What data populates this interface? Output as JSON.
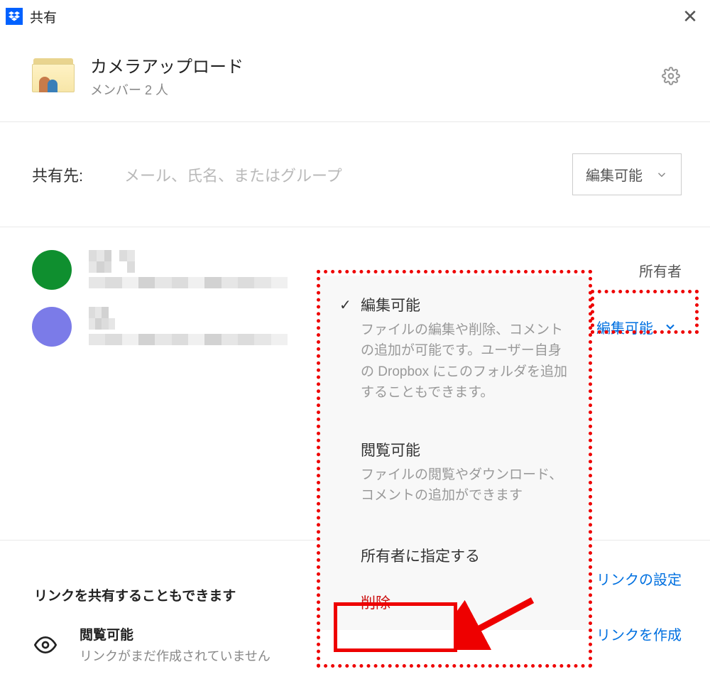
{
  "window": {
    "title": "共有"
  },
  "folder": {
    "name": "カメラアップロード",
    "members_label": "メンバー 2 人"
  },
  "share": {
    "label": "共有先:",
    "placeholder": "メール、氏名、またはグループ",
    "permission_selected": "編集可能"
  },
  "members": [
    {
      "role_label": "所有者"
    },
    {
      "role_label": "編集可能"
    }
  ],
  "popup": {
    "opt_edit": {
      "title": "編集可能",
      "desc": "ファイルの編集や削除、コメントの追加が可能です。ユーザー自身の Dropbox にこのフォルダを追加することもできます。"
    },
    "opt_view": {
      "title": "閲覧可能",
      "desc": "ファイルの閲覧やダウンロード、コメントの追加ができます"
    },
    "opt_owner": {
      "title": "所有者に指定する"
    },
    "opt_delete": {
      "title": "削除"
    }
  },
  "links": {
    "section_title": "リンクを共有することもできます",
    "view_title": "閲覧可能",
    "view_desc": "リンクがまだ作成されていません",
    "settings_label": "リンクの設定",
    "create_label": "リンクを作成"
  }
}
